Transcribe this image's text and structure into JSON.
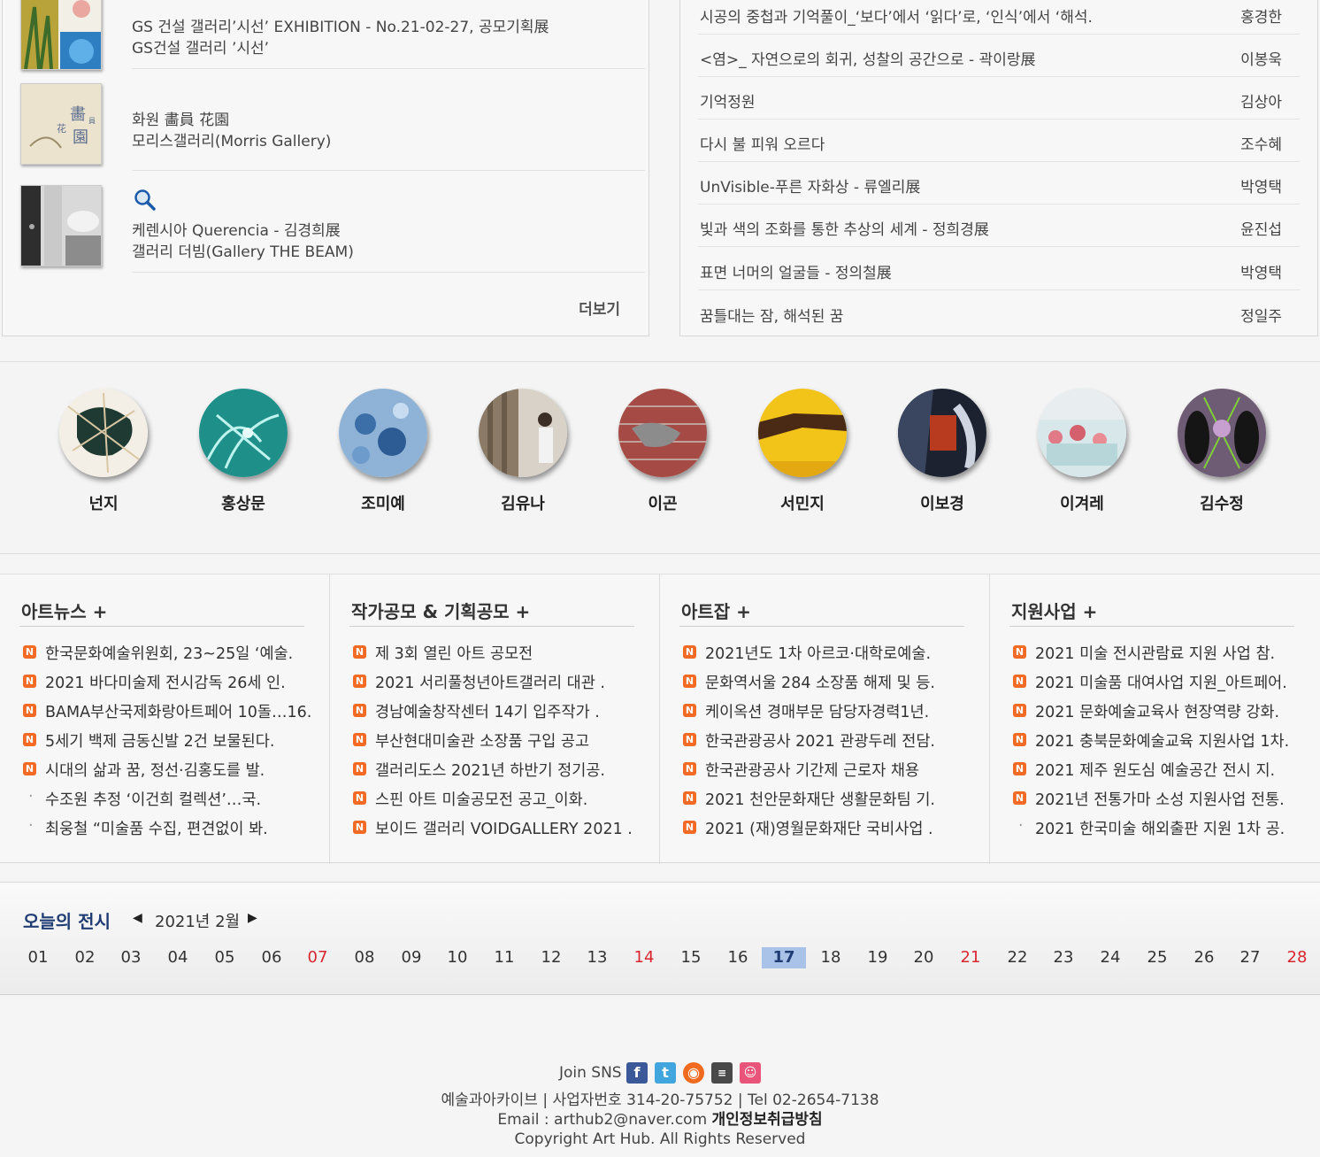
{
  "left_panel": {
    "items": [
      {
        "title": "GS 건설 갤러리’시선’ EXHIBITION - No.21-02-27, 공모기획展",
        "venue": "GS건설 갤러리 ’시선’"
      },
      {
        "title": "화원 畵員 花園",
        "venue": "모리스갤러리(Morris Gallery)"
      },
      {
        "title": "케렌시아 Querencia - 김경희展",
        "venue": "갤러리 더빔(Gallery THE BEAM)"
      }
    ],
    "more_label": "더보기"
  },
  "right_panel": {
    "rows": [
      {
        "title": "시공의 중첩과 기억풀이_‘보다’에서 ‘읽다’로, ‘인식’에서 ‘해석.",
        "author": "홍경한"
      },
      {
        "title": "<염>_ 자연으로의 회귀, 성찰의 공간으로 - 곽이랑展",
        "author": "이봉욱"
      },
      {
        "title": "기억정원",
        "author": "김상아"
      },
      {
        "title": "다시 불 피워 오르다",
        "author": "조수혜"
      },
      {
        "title": "UnVisible-푸른 자화상 - 류엘리展",
        "author": "박영택"
      },
      {
        "title": "빛과 색의 조화를 통한 추상의 세계 - 정희경展",
        "author": "윤진섭"
      },
      {
        "title": "표면 너머의 얼굴들 - 정의철展",
        "author": "박영택"
      },
      {
        "title": "꿈틀대는 잠, 해석된 꿈",
        "author": "정일주"
      }
    ]
  },
  "artists": [
    {
      "name": "넌지"
    },
    {
      "name": "홍상문"
    },
    {
      "name": "조미예"
    },
    {
      "name": "김유나"
    },
    {
      "name": "이곤"
    },
    {
      "name": "서민지"
    },
    {
      "name": "이보경"
    },
    {
      "name": "이겨레"
    },
    {
      "name": "김수정"
    }
  ],
  "news": [
    {
      "title": "아트뉴스 +",
      "items": [
        {
          "text": "한국문화예술위원회, 23~25일 ‘예술.",
          "new": true
        },
        {
          "text": "2021 바다미술제 전시감독 26세 인.",
          "new": true
        },
        {
          "text": "BAMA부산국제화랑아트페어 10돌…16.",
          "new": true
        },
        {
          "text": "5세기 백제 금동신발 2건 보물된다.",
          "new": true
        },
        {
          "text": "시대의 삶과 꿈, 정선·김홍도를 발.",
          "new": true
        },
        {
          "text": "수조원 추정 ‘이건희 컬렉션’…국.",
          "new": false
        },
        {
          "text": "최웅철 “미술품 수집, 편견없이 봐.",
          "new": false
        }
      ]
    },
    {
      "title": "작가공모 & 기획공모 +",
      "items": [
        {
          "text": "제 3회 열린 아트 공모전",
          "new": true
        },
        {
          "text": "2021 서리풀청년아트갤러리 대관 .",
          "new": true
        },
        {
          "text": "경남예술창작센터 14기 입주작가 .",
          "new": true
        },
        {
          "text": "부산현대미술관 소장품 구입 공고",
          "new": true
        },
        {
          "text": "갤러리도스 2021년 하반기 정기공.",
          "new": true
        },
        {
          "text": "스핀 아트 미술공모전 공고_이화.",
          "new": true
        },
        {
          "text": "보이드 갤러리 VOIDGALLERY 2021 .",
          "new": true
        }
      ]
    },
    {
      "title": "아트잡 +",
      "items": [
        {
          "text": "2021년도 1차 아르코·대학로예술.",
          "new": true
        },
        {
          "text": "문화역서울 284 소장품 해제 및 등.",
          "new": true
        },
        {
          "text": "케이옥션 경매부문 담당자경력1년.",
          "new": true
        },
        {
          "text": "한국관광공사 2021 관광두레 전담.",
          "new": true
        },
        {
          "text": "한국관광공사 기간제 근로자 채용",
          "new": true
        },
        {
          "text": "2021 천안문화재단 생활문화팀 기.",
          "new": true
        },
        {
          "text": "2021 (재)영월문화재단 국비사업 .",
          "new": true
        }
      ]
    },
    {
      "title": "지원사업 +",
      "items": [
        {
          "text": "2021 미술 전시관람료 지원 사업 참.",
          "new": true
        },
        {
          "text": "2021 미술품 대여사업 지원_아트페어.",
          "new": true
        },
        {
          "text": "2021 문화예술교육사 현장역량 강화.",
          "new": true
        },
        {
          "text": "2021 충북문화예술교육 지원사업 1차.",
          "new": true
        },
        {
          "text": "2021 제주 원도심 예술공간 전시 지.",
          "new": true
        },
        {
          "text": "2021년 전통가마 소성 지원사업 전통.",
          "new": true
        },
        {
          "text": "2021 한국미술 해외출판 지원 1차 공.",
          "new": false
        }
      ]
    }
  ],
  "today": {
    "title": "오늘의 전시",
    "prev": "◀",
    "month": "2021년 2월",
    "next": "▶",
    "days": [
      "01",
      "02",
      "03",
      "04",
      "05",
      "06",
      "07",
      "08",
      "09",
      "10",
      "11",
      "12",
      "13",
      "14",
      "15",
      "16",
      "17",
      "18",
      "19",
      "20",
      "21",
      "22",
      "23",
      "24",
      "25",
      "26",
      "27",
      "28"
    ],
    "red_days": [
      "07",
      "14",
      "21",
      "28"
    ],
    "selected_day": "17"
  },
  "footer": {
    "join_sns": "Join SNS",
    "sns_icons": [
      "facebook-icon",
      "twitter-icon",
      "rss-icon",
      "me2day-icon",
      "cyworld-icon"
    ],
    "line1": "예술과아카이브 | 사업자번호 314-20-75752 | Tel 02-2654-7138",
    "email": "Email : arthub2@naver.com",
    "privacy": "개인정보취급방침",
    "copyright": "Copyright Art Hub. All Rights Reserved"
  }
}
